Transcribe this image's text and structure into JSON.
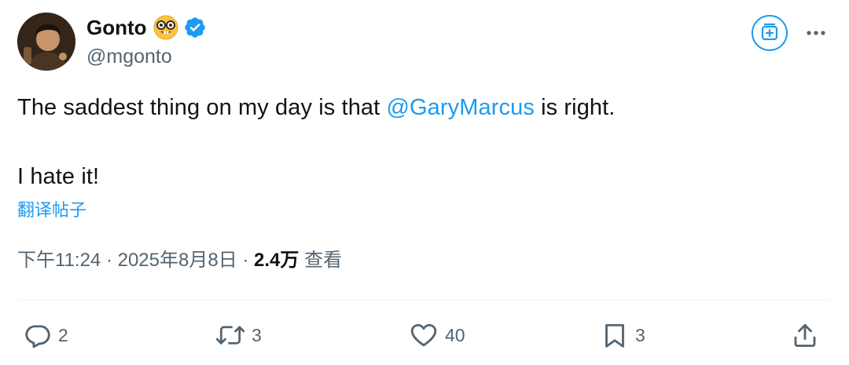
{
  "author": {
    "display_name": "Gonto",
    "handle": "@mgonto",
    "emoji_icon": "nerd-face-emoji",
    "verified_icon": "verified-badge-icon"
  },
  "tweet": {
    "text_before_mention": "The saddest thing on my day is that ",
    "mention": "@GaryMarcus",
    "text_after_mention": " is right.",
    "line2": "I hate it!"
  },
  "translate_label": "翻译帖子",
  "meta": {
    "time": "下午11:24",
    "separator": " · ",
    "date": "2025年8月8日",
    "views_count": "2.4万",
    "views_label": " 查看"
  },
  "actions": {
    "replies": "2",
    "reposts": "3",
    "likes": "40",
    "bookmarks": "3"
  },
  "colors": {
    "accent": "#1d9bf0",
    "text": "#0f1419",
    "secondary": "#536471",
    "divider": "#eff3f4"
  }
}
